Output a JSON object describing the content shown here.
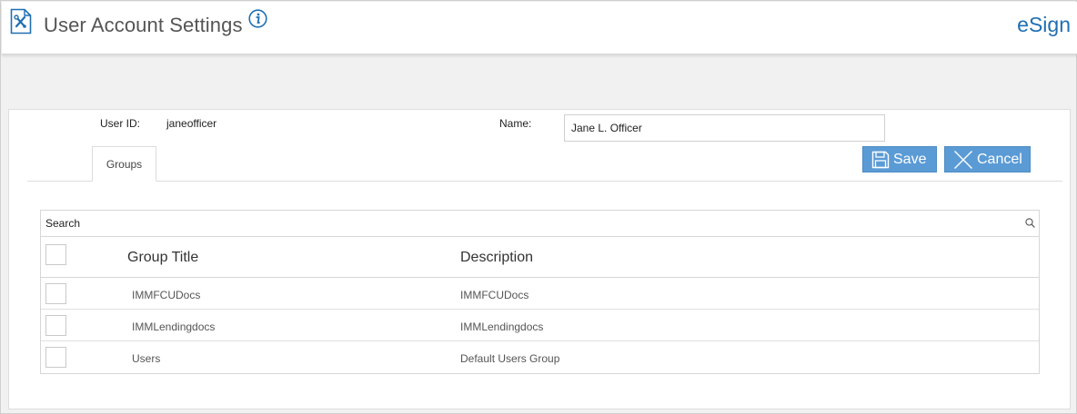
{
  "header": {
    "title": "User Account Settings",
    "brand": "eSign",
    "page_icon": "settings-tools-icon",
    "info_icon": "info-icon"
  },
  "user": {
    "user_id_label": "User ID:",
    "user_id_value": "janeofficer",
    "name_label": "Name:",
    "name_value": "Jane L. Officer"
  },
  "tabs": [
    {
      "label": "Groups",
      "active": true
    }
  ],
  "actions": {
    "save_label": "Save",
    "cancel_label": "Cancel"
  },
  "search": {
    "placeholder": "Search"
  },
  "table": {
    "columns": [
      "Group Title",
      "Description"
    ],
    "rows": [
      {
        "title": "IMMFCUDocs",
        "description": "IMMFCUDocs",
        "checked": false
      },
      {
        "title": "IMMLendingdocs",
        "description": "IMMLendingdocs",
        "checked": false
      },
      {
        "title": "Users",
        "description": "Default Users Group",
        "checked": false
      }
    ]
  },
  "colors": {
    "accent": "#1f6fb2",
    "button": "#5b9bd5",
    "background": "#f1f1f1"
  }
}
